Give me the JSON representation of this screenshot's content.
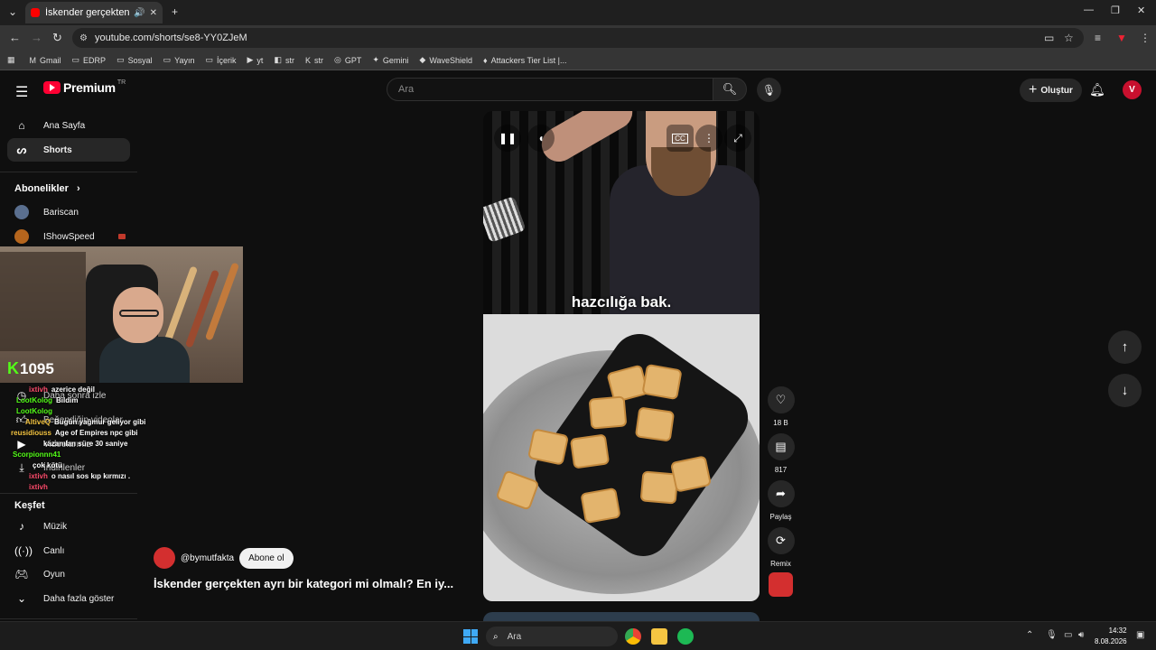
{
  "browser": {
    "tab_title": "İskender gerçekten ayrı bir",
    "url": "youtube.com/shorts/se8-YY0ZJeM",
    "bookmarks": [
      {
        "label": "Gmail",
        "icon": "gmail-icon"
      },
      {
        "label": "EDRP",
        "icon": "folder-icon"
      },
      {
        "label": "Sosyal",
        "icon": "folder-icon"
      },
      {
        "label": "Yayın",
        "icon": "folder-icon"
      },
      {
        "label": "İçerik",
        "icon": "folder-icon"
      },
      {
        "label": "yt",
        "icon": "youtube-icon"
      },
      {
        "label": "str",
        "icon": "twitch-icon"
      },
      {
        "label": "str",
        "icon": "kick-icon"
      },
      {
        "label": "GPT",
        "icon": "chatgpt-icon"
      },
      {
        "label": "Gemini",
        "icon": "gemini-icon"
      },
      {
        "label": "WaveShield",
        "icon": "waveshield-icon"
      },
      {
        "label": "Attackers Tier List |...",
        "icon": "attackers-icon"
      }
    ]
  },
  "masthead": {
    "logo_text": "Premium",
    "logo_sup": "TR",
    "search_placeholder": "Ara",
    "create_label": "Oluştur"
  },
  "sidebar": {
    "items": [
      {
        "label": "Ana Sayfa",
        "icon": "home-icon"
      },
      {
        "label": "Shorts",
        "icon": "shorts-icon"
      }
    ],
    "subs_heading": "Abonelikler",
    "subs": [
      {
        "label": "Bariscan"
      },
      {
        "label": "IShowSpeed"
      }
    ],
    "hidden_items": [
      {
        "label": "Daha sonra izle"
      },
      {
        "label": "Beğendiğin videolar"
      },
      {
        "label": "Videolarınız"
      },
      {
        "label": "İndirilenler"
      }
    ],
    "explore_heading": "Keşfet",
    "explore": [
      {
        "label": "Müzik",
        "icon": "music-icon"
      },
      {
        "label": "Canlı",
        "icon": "live-icon"
      },
      {
        "label": "Oyun",
        "icon": "gaming-icon"
      },
      {
        "label": "Daha fazla göster",
        "icon": "chevron-down-icon"
      }
    ]
  },
  "overlay": {
    "kick_count": "1095",
    "chat": [
      {
        "user": "ixtivh",
        "msg": "azerice değil",
        "color": "#ff4d6d"
      },
      {
        "user": "LootKolog",
        "msg": "Bildim",
        "color": "#53fc18"
      },
      {
        "user": "LootKolog",
        "msg": "",
        "color": "#53fc18"
      },
      {
        "user": "AltiveQ",
        "msg": "Bugün yağmur geliyor gibi",
        "color": "#f5c542"
      },
      {
        "user": "reusidiouss",
        "msg": "Age of Empires npc gibi",
        "color": "#f5c542"
      },
      {
        "user": "",
        "msg": "kazanılan süre 30 saniye",
        "color": "#ff4d6d"
      },
      {
        "user": "Scorpionnn41",
        "msg": "",
        "color": "#53fc18"
      },
      {
        "user": "",
        "msg": "çok kötü",
        "color": "#ff4d6d"
      },
      {
        "user": "ixtivh",
        "msg": "o nasıl sos kıp kırmızı .",
        "color": "#ff4d6d"
      },
      {
        "user": "ixtivh",
        "msg": "",
        "color": "#ff4d6d"
      }
    ]
  },
  "short": {
    "subtitle": "hazcılığa bak.",
    "like_count": "18 B",
    "comment_count": "817",
    "share_label": "Paylaş",
    "remix_label": "Remix",
    "channel": "@bymutfakta",
    "subscribe_label": "Abone ol",
    "title": "İskender gerçekten ayrı bir kategori mi olmalı? En iy..."
  },
  "taskbar": {
    "search_placeholder": "Ara",
    "time": "14:32",
    "date": "8.08.2026"
  },
  "colors": {
    "brand": "#ff0033",
    "bg": "#0f0f0f",
    "kick": "#53fc18"
  }
}
